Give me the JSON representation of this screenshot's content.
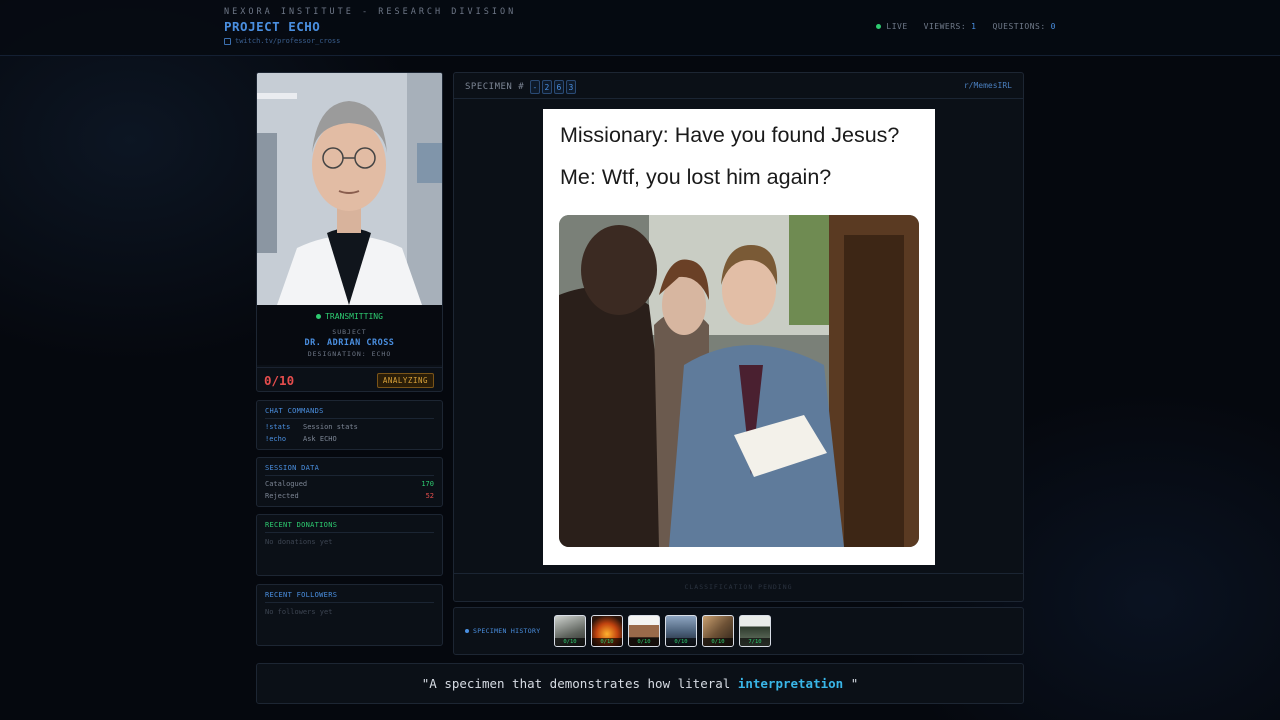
{
  "header": {
    "org": "NEXORA INSTITUTE - RESEARCH DIVISION",
    "project": "PROJECT ECHO",
    "channel": "twitch.tv/professor_cross",
    "live_label": "LIVE",
    "viewers_label": "VIEWERS:",
    "viewers_value": "1",
    "questions_label": "QUESTIONS:",
    "questions_value": "0"
  },
  "profile": {
    "status": "TRANSMITTING",
    "subject_label": "SUBJECT",
    "subject_name": "DR. ADRIAN CROSS",
    "designation": "DESIGNATION: ECHO",
    "score": "0/10",
    "state_badge": "ANALYZING"
  },
  "chat_commands": {
    "title": "CHAT COMMANDS",
    "items": [
      {
        "cmd": "!stats",
        "desc": "Session stats"
      },
      {
        "cmd": "!echo",
        "desc": "Ask ECHO"
      }
    ]
  },
  "session_data": {
    "title": "SESSION DATA",
    "catalogued_label": "Catalogued",
    "catalogued_value": "170",
    "rejected_label": "Rejected",
    "rejected_value": "52"
  },
  "donations": {
    "title": "RECENT DONATIONS",
    "empty": "No donations yet"
  },
  "followers": {
    "title": "RECENT FOLLOWERS",
    "empty": "No followers yet"
  },
  "specimen": {
    "label": "SPECIMEN #",
    "digits": [
      "-",
      "2",
      "6",
      "3"
    ],
    "subreddit": "r/MemesIRL",
    "meme_line1": "Missionary: Have you found Jesus?",
    "meme_line2": "Me: Wtf, you lost him again?",
    "footer": "CLASSIFICATION PENDING"
  },
  "history": {
    "label": "SPECIMEN HISTORY",
    "scores": [
      "0/10",
      "0/10",
      "0/10",
      "0/10",
      "0/10",
      "7/10"
    ]
  },
  "quote": {
    "before": "\"A specimen that demonstrates how literal ",
    "highlight": "interpretation",
    "after": " \""
  },
  "colors": {
    "accent": "#4a8fe0",
    "live": "#2ecc71",
    "danger": "#e54d4d",
    "warning": "#d9a23a",
    "highlight": "#39b6e8"
  }
}
